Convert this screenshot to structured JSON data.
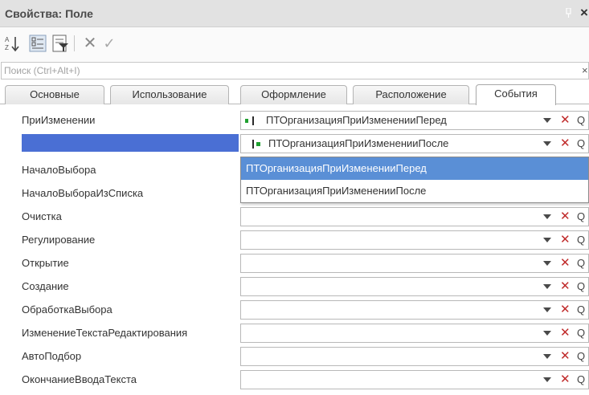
{
  "window": {
    "title": "Свойства: Поле",
    "close_label": "×"
  },
  "toolbar": {
    "sort_icon": "sort-alpha-icon",
    "categories_icon": "categories-icon",
    "filter_icon": "filter-icon",
    "cancel_label": "✕",
    "confirm_label": "✓"
  },
  "search": {
    "placeholder": "Поиск (Ctrl+Alt+I)",
    "clear_label": "×"
  },
  "tabs": [
    {
      "label": "Основные"
    },
    {
      "label": "Использование"
    },
    {
      "label": "Оформление"
    },
    {
      "label": "Расположение"
    },
    {
      "label": "События",
      "active": true
    }
  ],
  "properties": [
    {
      "name": "ПриИзменении",
      "value": "ПТОрганизацияПриИзмененииПеред",
      "icon": "module-green-icon"
    },
    {
      "name": "",
      "value": "ПТОрганизацияПриИзмененииПосле",
      "icon": "module-green-icon",
      "selected": true
    },
    {
      "name": "НачалоВыбора",
      "value": ""
    },
    {
      "name": "НачалоВыбораИзСписка",
      "value": ""
    },
    {
      "name": "Очистка",
      "value": ""
    },
    {
      "name": "Регулирование",
      "value": ""
    },
    {
      "name": "Открытие",
      "value": ""
    },
    {
      "name": "Создание",
      "value": ""
    },
    {
      "name": "ОбработкаВыбора",
      "value": ""
    },
    {
      "name": "ИзменениеТекстаРедактирования",
      "value": ""
    },
    {
      "name": "АвтоПодбор",
      "value": ""
    },
    {
      "name": "ОкончаниеВводаТекста",
      "value": ""
    }
  ],
  "field_buttons": {
    "clear": "✕",
    "open": "Q"
  },
  "dropdown": {
    "options": [
      {
        "label": "ПТОрганизацияПриИзмененииПеред",
        "highlighted": true
      },
      {
        "label": "ПТОрганизацияПриИзмененииПосле",
        "highlighted": false
      }
    ]
  },
  "colors": {
    "selection": "#4a6fd4",
    "highlight": "#5a8fd6",
    "clear_button": "#c02a2a",
    "module_icon": "#1fa02f"
  }
}
